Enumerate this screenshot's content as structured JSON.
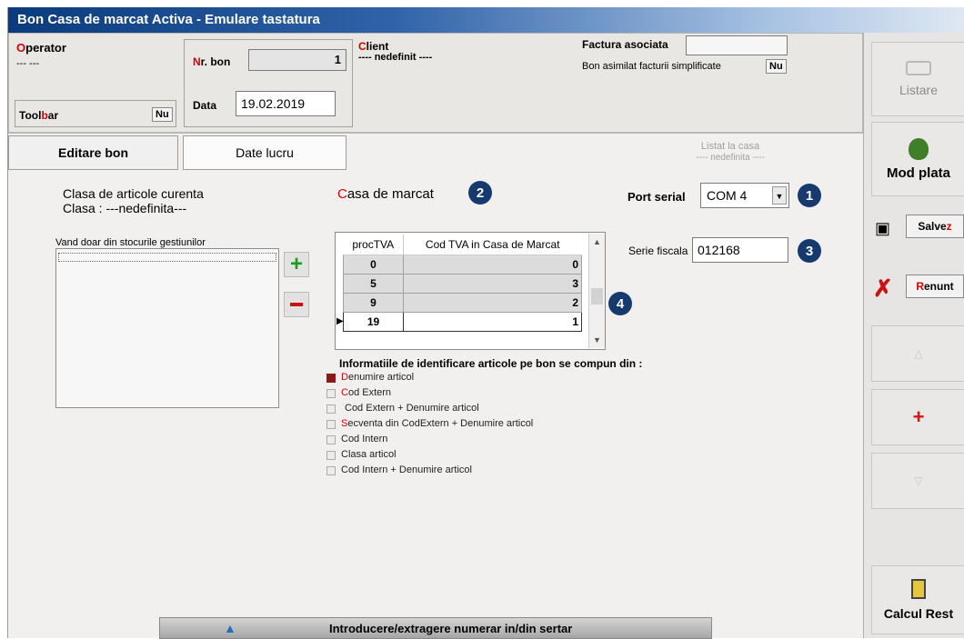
{
  "window": {
    "title": "Bon Casa de marcat Activa - Emulare tastatura"
  },
  "header": {
    "operator_label_first": "O",
    "operator_label_rest": "perator",
    "operator_value": "--- ---",
    "toolbar_label_a": "Tool",
    "toolbar_label_b": "b",
    "toolbar_label_c": "ar",
    "toolbar_value": "Nu",
    "nr_bon_label_first": "N",
    "nr_bon_label_rest": "r. bon",
    "nr_bon_value": "1",
    "data_label": "Data",
    "data_value": "19.02.2019",
    "client_label_first": "C",
    "client_label_rest": "lient",
    "client_value": "---- nedefinit ----",
    "factura_label": "Factura asociata",
    "factura_value": "",
    "bon_asimilat_label": "Bon asimilat facturii simplificate",
    "bon_asimilat_value": "Nu"
  },
  "tabs": [
    {
      "label": "Editare bon"
    },
    {
      "label": "Date lucru"
    }
  ],
  "listat": {
    "line1": "Listat la casa",
    "line2": "---- nedefinita ----"
  },
  "left": {
    "clasa_title": "Clasa de articole curenta",
    "clasa_value": "Clasa : ---nedefinita---",
    "vand_label": "Vand doar din stocurile gestiunilor"
  },
  "casa": {
    "label_first": "C",
    "label_rest": "asa de marcat",
    "badge": "2"
  },
  "port": {
    "label": "Port serial",
    "value": "COM 4",
    "badge": "1"
  },
  "serie": {
    "label": "Serie fiscala",
    "value": "012168",
    "badge": "3"
  },
  "grid": {
    "headers": [
      "procTVA",
      "Cod TVA in Casa de Marcat"
    ],
    "rows": [
      [
        "0",
        "0"
      ],
      [
        "5",
        "3"
      ],
      [
        "9",
        "2"
      ],
      [
        "19",
        "1"
      ]
    ],
    "badge": "4"
  },
  "info": {
    "title": "Informatiile de identificare articole  pe bon se compun din :",
    "options": [
      {
        "first": "D",
        "rest": "enumire articol",
        "checked": true
      },
      {
        "first": "C",
        "rest": "od Extern",
        "checked": false
      },
      {
        "first": "",
        "rest": "Cod Extern + Denumire articol",
        "checked": false
      },
      {
        "first": "S",
        "rest": "ecventa din CodExtern + Denumire articol",
        "checked": false
      },
      {
        "first": "",
        "rest": "Cod Intern",
        "checked": false
      },
      {
        "first": "",
        "rest": "Clasa articol",
        "checked": false
      },
      {
        "first": "",
        "rest": "Cod Intern + Denumire articol",
        "checked": false
      }
    ]
  },
  "bottom": {
    "label": "Introducere/extragere numerar in/din sertar"
  },
  "sidebar": {
    "listare": "Listare",
    "mod_plata": "Mod plata",
    "salvez_a": "Salve",
    "salvez_b": "z",
    "renunt_a": "R",
    "renunt_b": "enunt",
    "calcul_rest": "Calcul Rest"
  },
  "colors": {
    "accent_red": "#d40000",
    "badge_blue": "#163a6e",
    "title_blue": "#0b3b7c"
  }
}
